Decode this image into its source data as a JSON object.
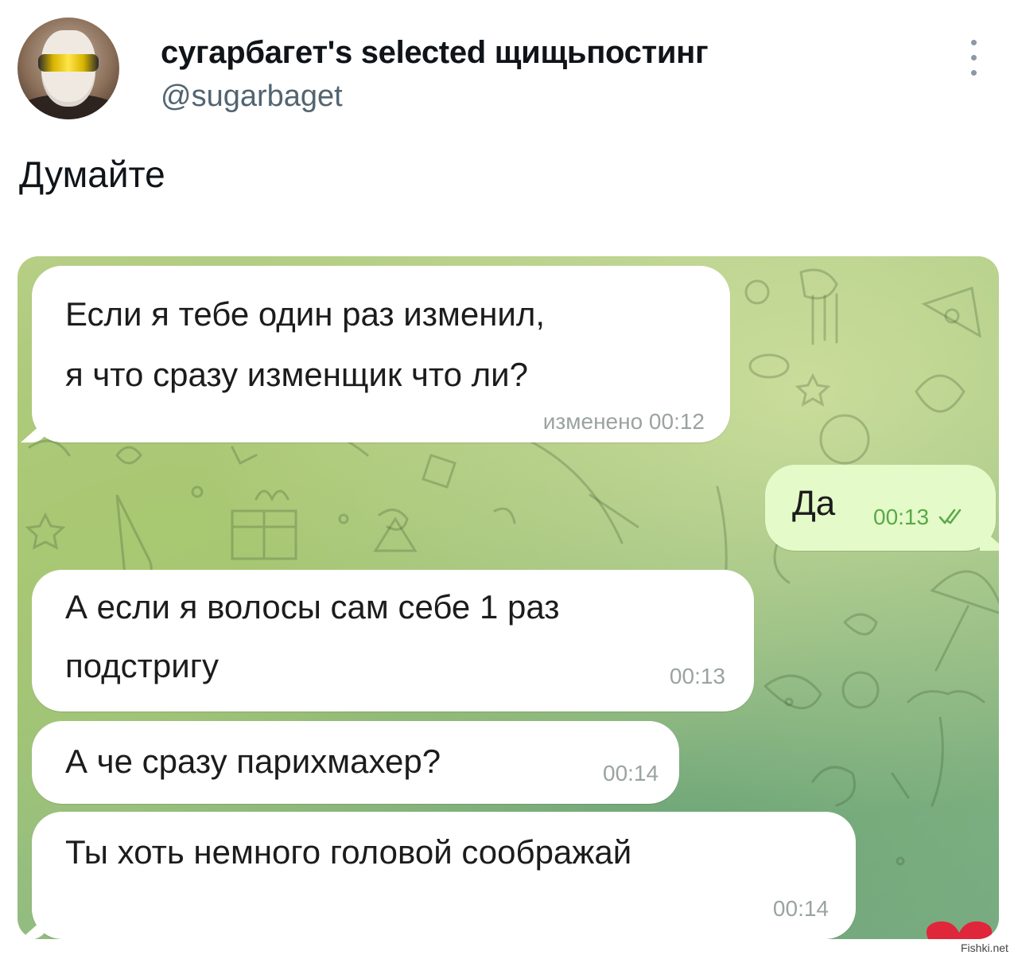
{
  "post": {
    "display_name": "сугарбагет's ѕеlесtеd щищьпостинг",
    "handle": "@sugarbaget",
    "text": "Думайте",
    "more_icon": "more-vertical-icon",
    "avatar": "avatar"
  },
  "chat": {
    "messages": [
      {
        "direction": "in",
        "lines": [
          "Если я тебе один раз изменил,",
          "я что сразу изменщик что ли?"
        ],
        "time": "изменено 00:12"
      },
      {
        "direction": "out",
        "lines": [
          "Да"
        ],
        "time": "00:13",
        "status_icon": "double-check-icon"
      },
      {
        "direction": "in",
        "lines": [
          "А если я волосы сам себе 1 раз",
          "подстригу"
        ],
        "time": "00:13"
      },
      {
        "direction": "in",
        "lines": [
          "А че сразу парихмахер?"
        ],
        "time": "00:14"
      },
      {
        "direction": "in",
        "lines": [
          "Ты хоть немного головой соображай"
        ],
        "time": "00:14"
      }
    ],
    "colors": {
      "incoming_bubble": "#ffffff",
      "outgoing_bubble": "#e4fac8",
      "outgoing_time": "#5aa84a",
      "wallpaper_top": "#b9d08a",
      "wallpaper_bottom": "#7fb188"
    }
  },
  "watermark": "Fishki.net"
}
